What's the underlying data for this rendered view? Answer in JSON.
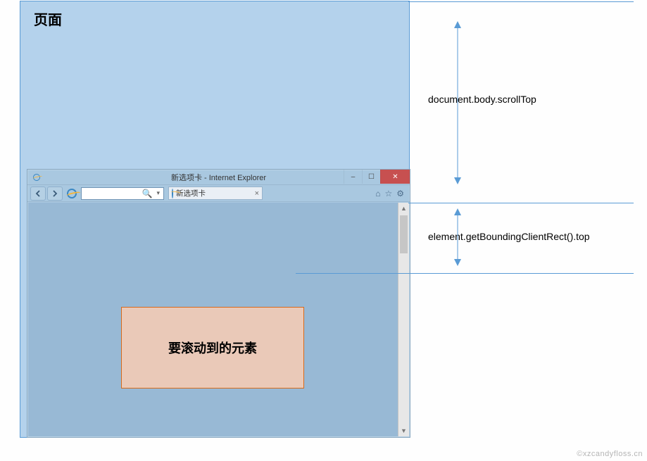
{
  "page": {
    "label": "页面"
  },
  "browser": {
    "title": "新选项卡 - Internet Explorer",
    "toolbar": {
      "back_tip": "返回",
      "forward_tip": "前进",
      "address_dropdown": "▾",
      "search_glyph": "🔍",
      "tab_label": "新选项卡",
      "tab_close": "×",
      "win_min": "–",
      "win_max": "☐",
      "win_close": "✕",
      "home_glyph": "⌂",
      "star_glyph": "☆",
      "gear_glyph": "⚙"
    },
    "target_element_label": "要滚动到的元素"
  },
  "dims": {
    "scrollTop_label": "document.body.scrollTop",
    "rectTop_label": "element.getBoundingClientRect().top"
  },
  "watermark": "©xzcandyfloss.cn"
}
